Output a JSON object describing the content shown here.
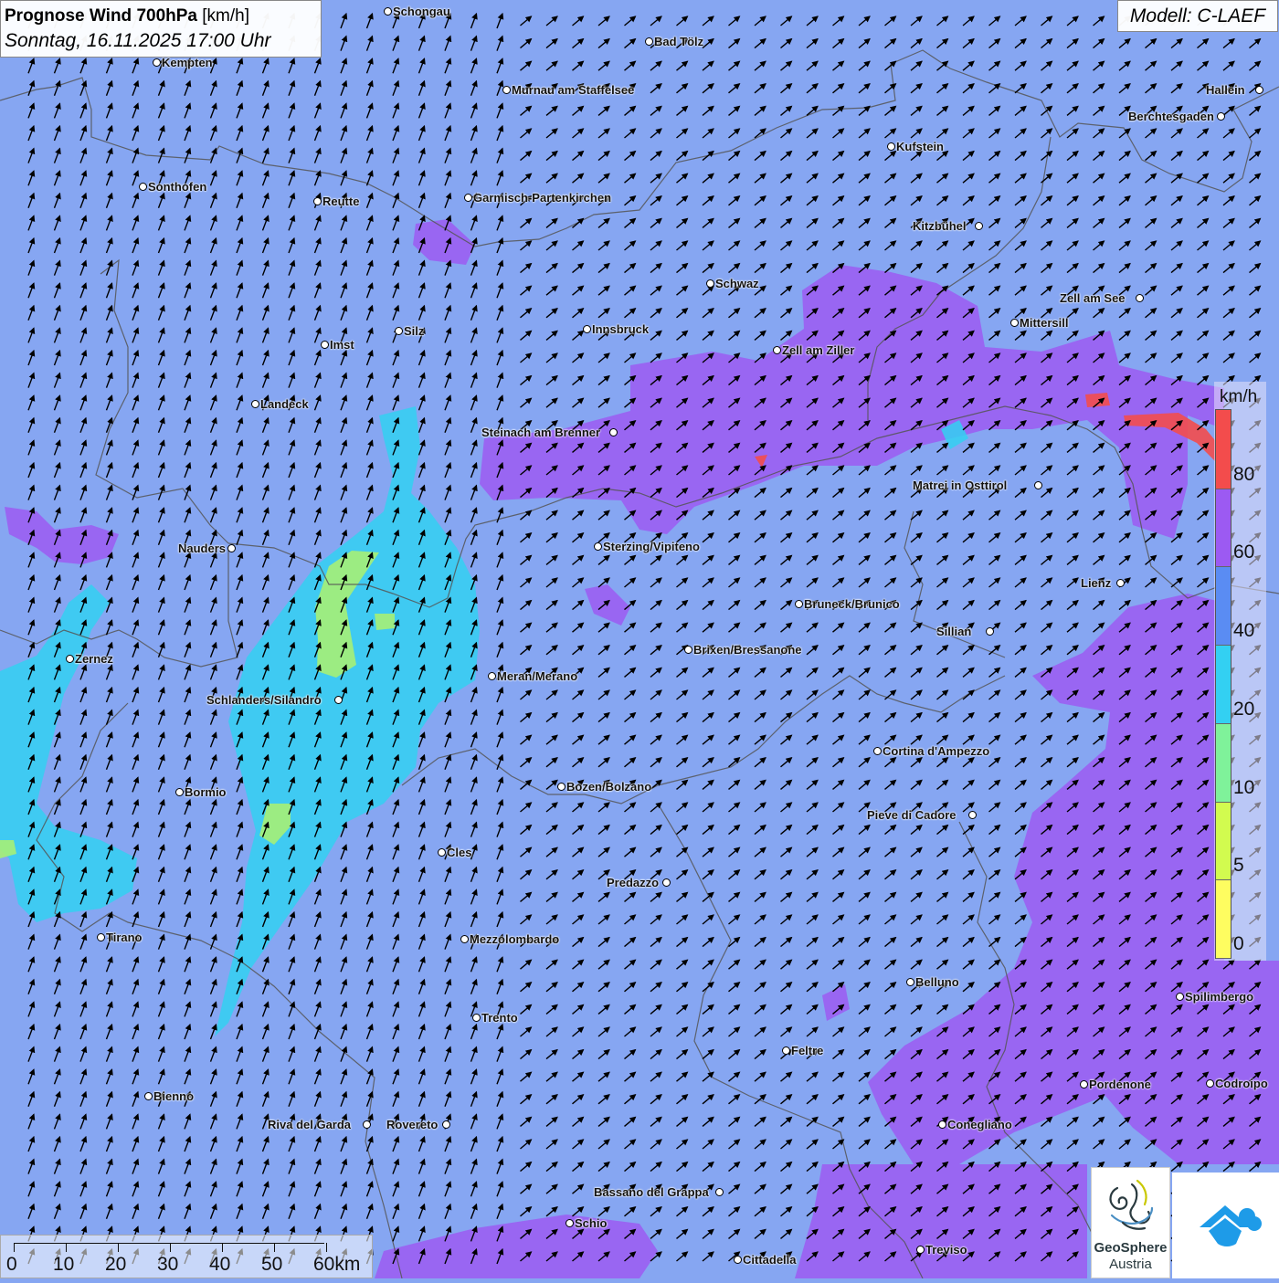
{
  "header": {
    "title_bold": "Prognose Wind 700hPa",
    "title_unit": "[km/h]",
    "datetime": "Sonntag, 16.11.2025 17:00 Uhr"
  },
  "model_label": "Modell: C-LAEF",
  "legend": {
    "unit": "km/h",
    "classes": [
      {
        "label": "0",
        "color": "#fefd60"
      },
      {
        "label": "5",
        "color": "#d2fb4f"
      },
      {
        "label": "10",
        "color": "#7ff29a"
      },
      {
        "label": "20",
        "color": "#33d0f2"
      },
      {
        "label": "40",
        "color": "#5a8cf3"
      },
      {
        "label": "60",
        "color": "#9c5af2"
      },
      {
        "label": "80",
        "color": "#f34c4c"
      }
    ]
  },
  "scale_bar": {
    "labels": [
      "0",
      "10",
      "20",
      "30",
      "40",
      "50",
      "60km"
    ]
  },
  "cities": [
    {
      "name": "Schongau"
    },
    {
      "name": "Bad Tölz"
    },
    {
      "name": "Kempten"
    },
    {
      "name": "Murnau am Staffelsee"
    },
    {
      "name": "Hallein"
    },
    {
      "name": "Berchtesgaden"
    },
    {
      "name": "Kufstein"
    },
    {
      "name": "Sonthofen"
    },
    {
      "name": "Reutte"
    },
    {
      "name": "Garmisch-Partenkirchen"
    },
    {
      "name": "Kitzbühel"
    },
    {
      "name": "Schwaz"
    },
    {
      "name": "Zell am See"
    },
    {
      "name": "Mittersill"
    },
    {
      "name": "Imst"
    },
    {
      "name": "Silz"
    },
    {
      "name": "Innsbruck"
    },
    {
      "name": "Zell am Ziller"
    },
    {
      "name": "Landeck"
    },
    {
      "name": "Steinach am Brenner"
    },
    {
      "name": "Matrei in Osttirol"
    },
    {
      "name": "Nauders"
    },
    {
      "name": "Sterzing/Vipiteno"
    },
    {
      "name": "Lienz"
    },
    {
      "name": "Bruneck/Brunico"
    },
    {
      "name": "Sillian"
    },
    {
      "name": "Zernez"
    },
    {
      "name": "Brixen/Bressanone"
    },
    {
      "name": "Meran/Merano"
    },
    {
      "name": "Schlanders/Silandro"
    },
    {
      "name": "Cortina d'Ampezzo"
    },
    {
      "name": "Bozen/Bolzano"
    },
    {
      "name": "Bormio"
    },
    {
      "name": "Pieve di Cadore"
    },
    {
      "name": "Cles"
    },
    {
      "name": "Predazzo"
    },
    {
      "name": "Tirano"
    },
    {
      "name": "Mezzolombardo"
    },
    {
      "name": "Belluno"
    },
    {
      "name": "Spilimbergo"
    },
    {
      "name": "Trento"
    },
    {
      "name": "Feltre"
    },
    {
      "name": "Pordenone"
    },
    {
      "name": "Codroipo"
    },
    {
      "name": "Bienno"
    },
    {
      "name": "Riva del Garda"
    },
    {
      "name": "Rovereto"
    },
    {
      "name": "Conegliano"
    },
    {
      "name": "Bassano del Grappa"
    },
    {
      "name": "Schio"
    },
    {
      "name": "Treviso"
    },
    {
      "name": "Cittadella"
    }
  ],
  "logos": {
    "geosphere_line1": "GeoSphere",
    "geosphere_line2": "Austria"
  },
  "colors": {
    "base": "#86a6f2",
    "purple": "#9c5af2",
    "cyan": "#33d0f2",
    "green": "#a6ef76",
    "red": "#f34c4c",
    "border": "#555555"
  }
}
